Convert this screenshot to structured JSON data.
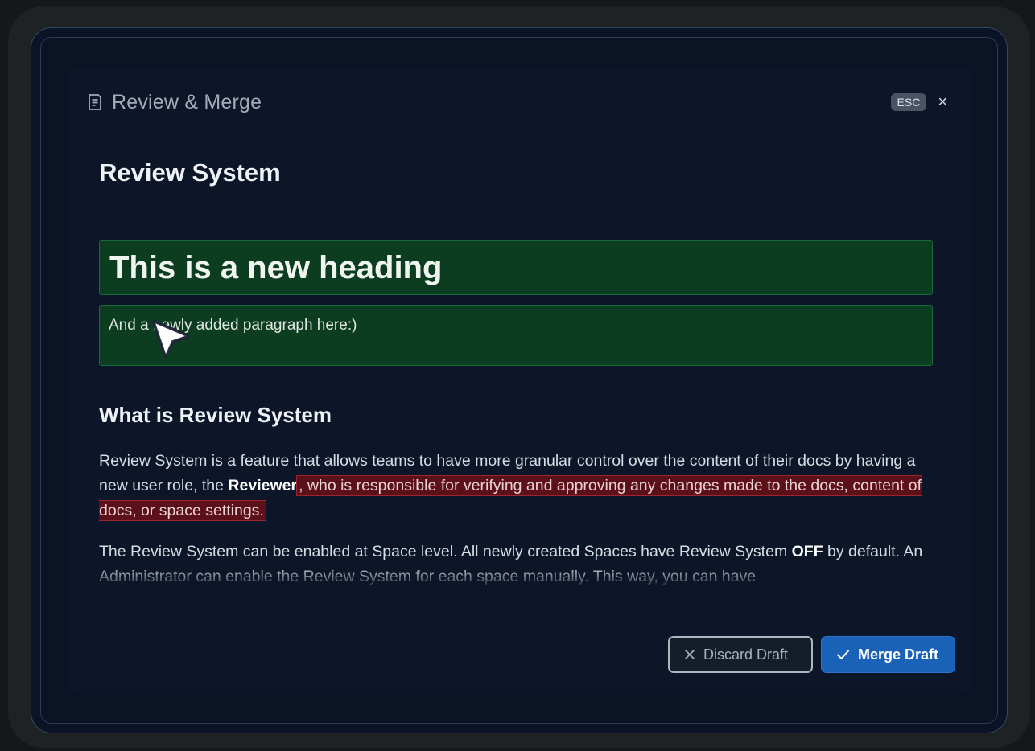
{
  "modal": {
    "title": "Review & Merge",
    "esc_label": "ESC",
    "close_glyph": "×"
  },
  "document": {
    "title": "Review System",
    "added_heading": "This is a new heading",
    "added_paragraph": "And a newly added paragraph here:)",
    "section_heading": "What is Review System",
    "paragraph1": {
      "before": "Review System is a feature that allows teams to have more granular control over the content of their docs by having a new user role, the ",
      "bold": "Reviewer",
      "removed": ", who is responsible for verifying and approving any changes made to the docs, content of docs, or space settings."
    },
    "paragraph2": {
      "before": "The Review System can be enabled at Space level. All newly created Spaces have Review System ",
      "bold": "OFF",
      "after": " by default. An Administrator can enable the Review System for each space manually. This way, you can have"
    }
  },
  "footer": {
    "discard_label": "Discard Draft",
    "merge_label": "Merge Draft"
  },
  "colors": {
    "added_bg": "#0c3d21",
    "removed_bg": "#5c1019",
    "primary": "#1a62b8"
  },
  "icons": {
    "title_icon": "document-icon",
    "discard_icon": "close-icon",
    "merge_icon": "check-icon",
    "pointer": "cursor-icon"
  }
}
